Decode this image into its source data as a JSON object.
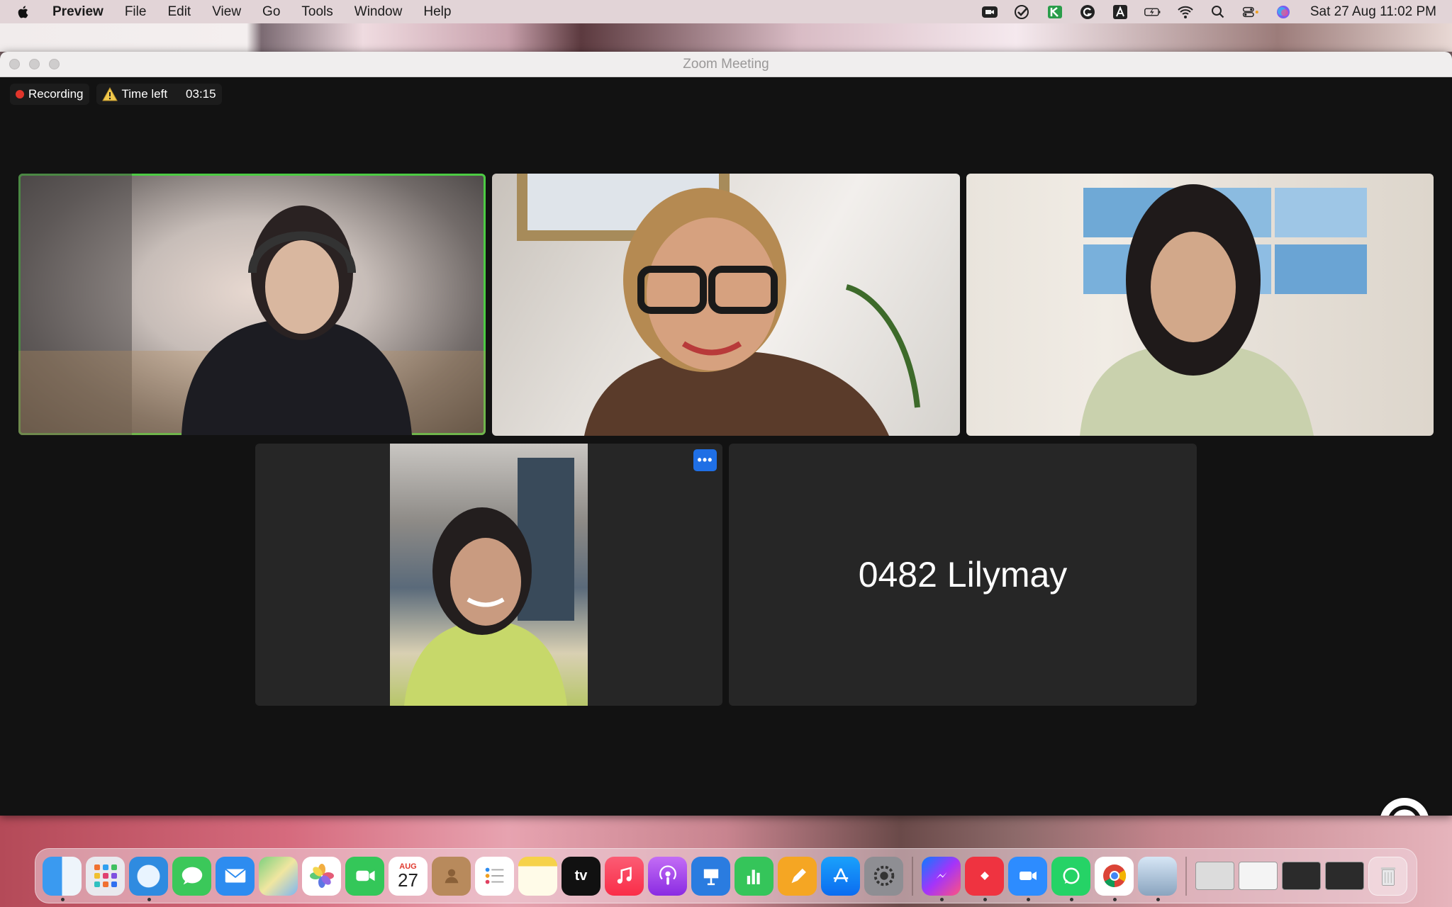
{
  "menubar": {
    "app_name": "Preview",
    "items": [
      "File",
      "Edit",
      "View",
      "Go",
      "Tools",
      "Window",
      "Help"
    ],
    "clock": "Sat 27 Aug  11:02 PM"
  },
  "window": {
    "title": "Zoom Meeting"
  },
  "meeting": {
    "recording_label": "Recording",
    "time_left_label": "Time left",
    "time_left_value": "03:15",
    "participant_name_tile": "0482 Lilymay",
    "more_button_label": "•••"
  },
  "dock": {
    "calendar_month": "AUG",
    "calendar_day": "27",
    "tv_label": "tv"
  },
  "colors": {
    "active_speaker": "#4ccb43",
    "recording": "#e0352b",
    "more_button": "#1f6fe5"
  }
}
